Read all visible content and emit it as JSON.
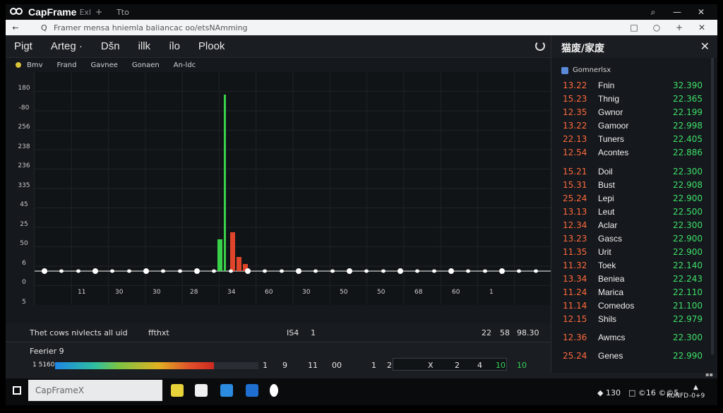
{
  "titlebar": {
    "app_title": "CapFrame",
    "tab_mark": "Exl",
    "new_tab": "+",
    "second_tab": "Tto",
    "controls": {
      "search": "⌕",
      "minimize": "—",
      "close": "✕"
    }
  },
  "addressbar": {
    "back": "←",
    "search_glyph": "Q",
    "url_text": "Framer mensa hniemla baliancac oo/etsNAmming",
    "tools": [
      "□",
      "○",
      "+",
      "✕"
    ]
  },
  "menu": {
    "items": [
      "Pigt",
      "Arteg ·",
      "Dšn",
      "illk",
      "ílo",
      "Plook"
    ]
  },
  "subbar": {
    "items": [
      "Bmv",
      "Frand",
      "Gavnee",
      "Gonaen",
      "An-ldc"
    ]
  },
  "yaxis": {
    "ticks": [
      "180",
      "-80",
      "256",
      "238",
      "236",
      "335",
      "45",
      "25",
      "50",
      "6",
      "0",
      "5"
    ]
  },
  "xaxis": {
    "ticks": [
      "11",
      "30",
      "30",
      "28",
      "34",
      "60",
      "30",
      "50",
      "50",
      "68",
      "60",
      "1"
    ]
  },
  "chart_data": {
    "type": "bar",
    "title": "",
    "xlabel": "",
    "ylabel": "",
    "series": [
      {
        "values": [
          0,
          0,
          0,
          0,
          0,
          0,
          0,
          0,
          0,
          0,
          0,
          0,
          0,
          0,
          0,
          0,
          0,
          0,
          0,
          0,
          18,
          100,
          14,
          0,
          0,
          0,
          0,
          0,
          0,
          0
        ]
      },
      {
        "values": [
          0,
          0,
          0,
          0,
          0,
          0,
          0,
          0,
          0,
          0,
          0,
          0,
          0,
          0,
          0,
          0,
          0,
          0,
          0,
          0,
          0,
          0,
          22,
          8,
          4,
          0,
          0,
          0,
          0,
          0
        ]
      }
    ],
    "grid": true,
    "colors": {
      "up": "#3ad14a",
      "down": "#e0452a",
      "baseline": "#ffffff",
      "background": "#111417"
    }
  },
  "statusrow": {
    "left_text": "Thet cows  nivlects  all  uid",
    "left_text2": "ffthxt",
    "mid_a": "IS4",
    "mid_b": "1",
    "right_a": "22",
    "right_b": "58",
    "right_c": "98.30"
  },
  "footer": {
    "label": "Feerier 9",
    "progress_text": "1 5160",
    "progress_fraction": 0.78,
    "pager": [
      "1",
      "9",
      "11",
      "00",
      "1",
      "2",
      "X",
      "2",
      "4",
      "10",
      "10"
    ]
  },
  "rpanel": {
    "title": "猫废/家废",
    "close": "✕",
    "sub_label": "Gomnerlsx",
    "rows": [
      {
        "code": "13.22",
        "name": "Fnin",
        "value": "32.390"
      },
      {
        "code": "15.23",
        "name": "Thnig",
        "value": "22.365"
      },
      {
        "code": "12.35",
        "name": "Gwnor",
        "value": "22.199"
      },
      {
        "code": "13.22",
        "name": "Gamoor",
        "value": "22.998"
      },
      {
        "code": "22.13",
        "name": "Tuners",
        "value": "22.405"
      },
      {
        "code": "12.54",
        "name": "Acontes",
        "value": "22.886"
      },
      {
        "code": "15.21",
        "name": "Doil",
        "value": "22.300"
      },
      {
        "code": "15.31",
        "name": "Bust",
        "value": "22.908"
      },
      {
        "code": "25.24",
        "name": "Lepi",
        "value": "22.900"
      },
      {
        "code": "13.13",
        "name": "Leut",
        "value": "22.500"
      },
      {
        "code": "12.34",
        "name": "Aclar",
        "value": "22.300"
      },
      {
        "code": "13.23",
        "name": "Gascs",
        "value": "22.900"
      },
      {
        "code": "11.35",
        "name": "Urit",
        "value": "22.900"
      },
      {
        "code": "11.32",
        "name": "Toek",
        "value": "22.140"
      },
      {
        "code": "13.34",
        "name": "Beniea",
        "value": "22.243"
      },
      {
        "code": "11.24",
        "name": "Marica",
        "value": "22.110"
      },
      {
        "code": "11.14",
        "name": "Comedos",
        "value": "21.100"
      },
      {
        "code": "12.15",
        "name": "Shils",
        "value": "22.979"
      },
      {
        "code": "12.36",
        "name": "Awmcs",
        "value": "22.300"
      },
      {
        "code": "25.24",
        "name": "Genes",
        "value": "22.990"
      }
    ]
  },
  "taskbar": {
    "search_placeholder": "CapFrameX",
    "tray_a": "◆ 130",
    "tray_b": "□ ©16 ©©5",
    "tray_c": "KUNFD",
    "tray_d": "▲",
    "tray_e": "-0+9"
  }
}
